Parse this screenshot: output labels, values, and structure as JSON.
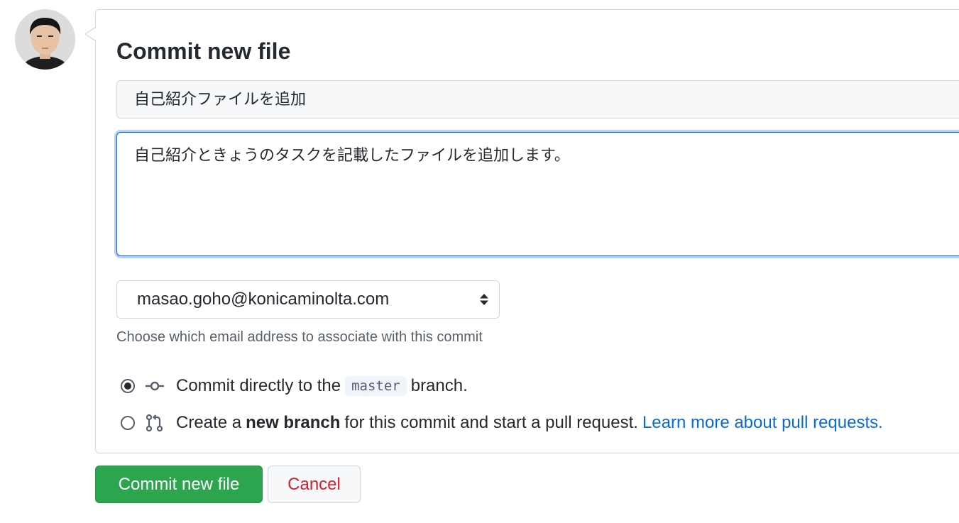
{
  "header": {
    "title": "Commit new file"
  },
  "commit": {
    "summary": "自己紹介ファイルを追加",
    "description": "自己紹介ときょうのタスクを記載したファイルを追加します。"
  },
  "email": {
    "selected": "masao.goho@konicaminolta.com",
    "help_text": "Choose which email address to associate with this commit"
  },
  "options": {
    "direct": {
      "prefix": "Commit directly to the",
      "branch": "master",
      "suffix": "branch.",
      "checked": true
    },
    "new_branch": {
      "prefix": "Create a",
      "bold": "new branch",
      "suffix": "for this commit and start a pull request.",
      "link": "Learn more about pull requests.",
      "checked": false
    }
  },
  "buttons": {
    "commit_label": "Commit new file",
    "cancel_label": "Cancel"
  },
  "colors": {
    "accent": "#0969da",
    "commit_button": "#2da44e",
    "cancel_text": "#cf222e"
  },
  "icons": {
    "avatar": "avatar",
    "commit": "git-commit-icon",
    "pull_request": "git-pull-request-icon"
  }
}
